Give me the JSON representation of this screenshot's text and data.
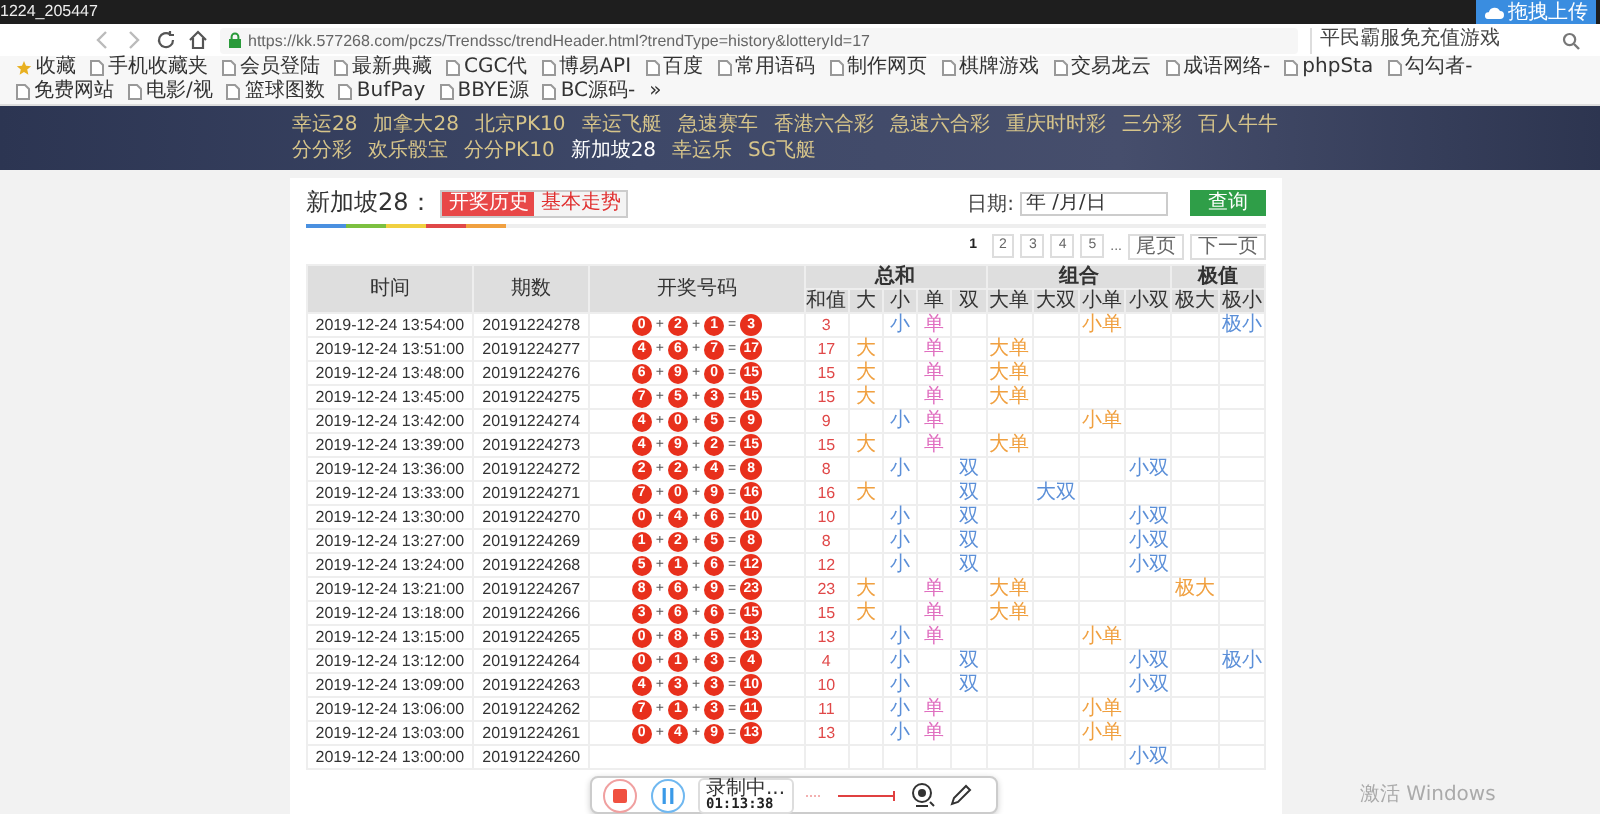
{
  "browser": {
    "tab_title": "1224_205447",
    "upload_button": "拖拽上传",
    "url": "https://kk.577268.com/pczs/Trendssc/trendHeader.html?trendType=history&lotteryId=17",
    "search": "平民霸服免充值游戏",
    "bookmarks": [
      {
        "label": "收藏",
        "kind": "star"
      },
      {
        "label": "手机收藏夹",
        "kind": "page"
      },
      {
        "label": "会员登陆",
        "kind": "page"
      },
      {
        "label": "最新典藏",
        "kind": "page"
      },
      {
        "label": "CGC代",
        "kind": "page"
      },
      {
        "label": "博易API",
        "kind": "page"
      },
      {
        "label": "百度",
        "kind": "page"
      },
      {
        "label": "常用语码",
        "kind": "page"
      },
      {
        "label": "制作网页",
        "kind": "page"
      },
      {
        "label": "棋牌游戏",
        "kind": "page"
      },
      {
        "label": "交易龙云",
        "kind": "page"
      },
      {
        "label": "成语网络-",
        "kind": "page"
      },
      {
        "label": "phpSta",
        "kind": "page"
      },
      {
        "label": "勾勾者-",
        "kind": "page"
      },
      {
        "label": "免费网站",
        "kind": "page"
      },
      {
        "label": "电影/视",
        "kind": "page"
      },
      {
        "label": "篮球图数",
        "kind": "page"
      },
      {
        "label": "BufPay",
        "kind": "page"
      },
      {
        "label": "BBYE源",
        "kind": "page"
      },
      {
        "label": "BC源码-",
        "kind": "page"
      },
      {
        "label": "»",
        "kind": "more"
      }
    ]
  },
  "nav": {
    "links": [
      {
        "label": "幸运28",
        "selected": false
      },
      {
        "label": "加拿大28",
        "selected": false
      },
      {
        "label": "北京PK10",
        "selected": false
      },
      {
        "label": "幸运飞艇",
        "selected": false
      },
      {
        "label": "急速赛车",
        "selected": false
      },
      {
        "label": "香港六合彩",
        "selected": false
      },
      {
        "label": "急速六合彩",
        "selected": false
      },
      {
        "label": "重庆时时彩",
        "selected": false
      },
      {
        "label": "三分彩",
        "selected": false
      },
      {
        "label": "百人牛牛",
        "selected": false
      },
      {
        "label": "分分彩",
        "selected": false
      },
      {
        "label": "欢乐骰宝",
        "selected": false
      },
      {
        "label": "分分PK10",
        "selected": false
      },
      {
        "label": "新加坡28",
        "selected": true
      },
      {
        "label": "幸运乐",
        "selected": false
      },
      {
        "label": "SG飞艇",
        "selected": false
      }
    ]
  },
  "panel": {
    "title": "新加坡28：",
    "tabs": [
      {
        "label": "开奖历史",
        "selected": true
      },
      {
        "label": "基本走势",
        "selected": false
      }
    ],
    "date_label": "日期:",
    "date_placeholder": "年 /月/日",
    "query_button": "查询",
    "pages": [
      {
        "label": "1",
        "kind": "page",
        "selected": true
      },
      {
        "label": "2",
        "kind": "page",
        "selected": false
      },
      {
        "label": "3",
        "kind": "page",
        "selected": false
      },
      {
        "label": "4",
        "kind": "page",
        "selected": false
      },
      {
        "label": "5",
        "kind": "page",
        "selected": false
      },
      {
        "label": "...",
        "kind": "ellipsis",
        "selected": false
      },
      {
        "label": "尾页",
        "kind": "link",
        "selected": false
      },
      {
        "label": "下一页",
        "kind": "link",
        "selected": false
      }
    ]
  },
  "table": {
    "columns": [
      "时间",
      "期数",
      "开奖号码"
    ],
    "operators": [
      "+",
      "+",
      "="
    ],
    "groups": [
      {
        "label": "总和",
        "sub": [
          {
            "label": "和值",
            "kind": "sum"
          },
          {
            "label": "大",
            "kind": "big"
          },
          {
            "label": "小",
            "kind": "small"
          },
          {
            "label": "单",
            "kind": "odd"
          },
          {
            "label": "双",
            "kind": "even"
          }
        ]
      },
      {
        "label": "组合",
        "sub": [
          {
            "label": "大单",
            "kind": "big_odd"
          },
          {
            "label": "大双",
            "kind": "big_even"
          },
          {
            "label": "小单",
            "kind": "small_odd"
          },
          {
            "label": "小双",
            "kind": "small_even"
          }
        ]
      },
      {
        "label": "极值",
        "sub": [
          {
            "label": "极大",
            "kind": "extreme_big"
          },
          {
            "label": "极小",
            "kind": "extreme_small"
          }
        ]
      }
    ],
    "rows": [
      {
        "time": "2019-12-24 13:54:00",
        "period": "20191224278",
        "numbers": [
          "0",
          "2",
          "1"
        ],
        "total": "3",
        "marks": [
          {
            "kind": "sum",
            "text": "3"
          },
          {
            "kind": "small",
            "text": "小"
          },
          {
            "kind": "odd",
            "text": "单"
          },
          {
            "kind": "small_odd",
            "text": "小单"
          },
          {
            "kind": "extreme_small",
            "text": "极小"
          }
        ]
      },
      {
        "time": "2019-12-24 13:51:00",
        "period": "20191224277",
        "numbers": [
          "4",
          "6",
          "7"
        ],
        "total": "17",
        "marks": [
          {
            "kind": "sum",
            "text": "17"
          },
          {
            "kind": "big",
            "text": "大"
          },
          {
            "kind": "odd",
            "text": "单"
          },
          {
            "kind": "big_odd",
            "text": "大单"
          }
        ]
      },
      {
        "time": "2019-12-24 13:48:00",
        "period": "20191224276",
        "numbers": [
          "6",
          "9",
          "0"
        ],
        "total": "15",
        "marks": [
          {
            "kind": "sum",
            "text": "15"
          },
          {
            "kind": "big",
            "text": "大"
          },
          {
            "kind": "odd",
            "text": "单"
          },
          {
            "kind": "big_odd",
            "text": "大单"
          }
        ]
      },
      {
        "time": "2019-12-24 13:45:00",
        "period": "20191224275",
        "numbers": [
          "7",
          "5",
          "3"
        ],
        "total": "15",
        "marks": [
          {
            "kind": "sum",
            "text": "15"
          },
          {
            "kind": "big",
            "text": "大"
          },
          {
            "kind": "odd",
            "text": "单"
          },
          {
            "kind": "big_odd",
            "text": "大单"
          }
        ]
      },
      {
        "time": "2019-12-24 13:42:00",
        "period": "20191224274",
        "numbers": [
          "4",
          "0",
          "5"
        ],
        "total": "9",
        "marks": [
          {
            "kind": "sum",
            "text": "9"
          },
          {
            "kind": "small",
            "text": "小"
          },
          {
            "kind": "odd",
            "text": "单"
          },
          {
            "kind": "small_odd",
            "text": "小单"
          }
        ]
      },
      {
        "time": "2019-12-24 13:39:00",
        "period": "20191224273",
        "numbers": [
          "4",
          "9",
          "2"
        ],
        "total": "15",
        "marks": [
          {
            "kind": "sum",
            "text": "15"
          },
          {
            "kind": "big",
            "text": "大"
          },
          {
            "kind": "odd",
            "text": "单"
          },
          {
            "kind": "big_odd",
            "text": "大单"
          }
        ]
      },
      {
        "time": "2019-12-24 13:36:00",
        "period": "20191224272",
        "numbers": [
          "2",
          "2",
          "4"
        ],
        "total": "8",
        "marks": [
          {
            "kind": "sum",
            "text": "8"
          },
          {
            "kind": "small",
            "text": "小"
          },
          {
            "kind": "even",
            "text": "双"
          },
          {
            "kind": "small_even",
            "text": "小双"
          }
        ]
      },
      {
        "time": "2019-12-24 13:33:00",
        "period": "20191224271",
        "numbers": [
          "7",
          "0",
          "9"
        ],
        "total": "16",
        "marks": [
          {
            "kind": "sum",
            "text": "16"
          },
          {
            "kind": "big",
            "text": "大"
          },
          {
            "kind": "even",
            "text": "双"
          },
          {
            "kind": "big_even",
            "text": "大双"
          }
        ]
      },
      {
        "time": "2019-12-24 13:30:00",
        "period": "20191224270",
        "numbers": [
          "0",
          "4",
          "6"
        ],
        "total": "10",
        "marks": [
          {
            "kind": "sum",
            "text": "10"
          },
          {
            "kind": "small",
            "text": "小"
          },
          {
            "kind": "even",
            "text": "双"
          },
          {
            "kind": "small_even",
            "text": "小双"
          }
        ]
      },
      {
        "time": "2019-12-24 13:27:00",
        "period": "20191224269",
        "numbers": [
          "1",
          "2",
          "5"
        ],
        "total": "8",
        "marks": [
          {
            "kind": "sum",
            "text": "8"
          },
          {
            "kind": "small",
            "text": "小"
          },
          {
            "kind": "even",
            "text": "双"
          },
          {
            "kind": "small_even",
            "text": "小双"
          }
        ]
      },
      {
        "time": "2019-12-24 13:24:00",
        "period": "20191224268",
        "numbers": [
          "5",
          "1",
          "6"
        ],
        "total": "12",
        "marks": [
          {
            "kind": "sum",
            "text": "12"
          },
          {
            "kind": "small",
            "text": "小"
          },
          {
            "kind": "even",
            "text": "双"
          },
          {
            "kind": "small_even",
            "text": "小双"
          }
        ]
      },
      {
        "time": "2019-12-24 13:21:00",
        "period": "20191224267",
        "numbers": [
          "8",
          "6",
          "9"
        ],
        "total": "23",
        "marks": [
          {
            "kind": "sum",
            "text": "23"
          },
          {
            "kind": "big",
            "text": "大"
          },
          {
            "kind": "odd",
            "text": "单"
          },
          {
            "kind": "big_odd",
            "text": "大单"
          },
          {
            "kind": "extreme_big",
            "text": "极大"
          }
        ]
      },
      {
        "time": "2019-12-24 13:18:00",
        "period": "20191224266",
        "numbers": [
          "3",
          "6",
          "6"
        ],
        "total": "15",
        "marks": [
          {
            "kind": "sum",
            "text": "15"
          },
          {
            "kind": "big",
            "text": "大"
          },
          {
            "kind": "odd",
            "text": "单"
          },
          {
            "kind": "big_odd",
            "text": "大单"
          }
        ]
      },
      {
        "time": "2019-12-24 13:15:00",
        "period": "20191224265",
        "numbers": [
          "0",
          "8",
          "5"
        ],
        "total": "13",
        "marks": [
          {
            "kind": "sum",
            "text": "13"
          },
          {
            "kind": "small",
            "text": "小"
          },
          {
            "kind": "odd",
            "text": "单"
          },
          {
            "kind": "small_odd",
            "text": "小单"
          }
        ]
      },
      {
        "time": "2019-12-24 13:12:00",
        "period": "20191224264",
        "numbers": [
          "0",
          "1",
          "3"
        ],
        "total": "4",
        "marks": [
          {
            "kind": "sum",
            "text": "4"
          },
          {
            "kind": "small",
            "text": "小"
          },
          {
            "kind": "even",
            "text": "双"
          },
          {
            "kind": "small_even",
            "text": "小双"
          },
          {
            "kind": "extreme_small",
            "text": "极小"
          }
        ]
      },
      {
        "time": "2019-12-24 13:09:00",
        "period": "20191224263",
        "numbers": [
          "4",
          "3",
          "3"
        ],
        "total": "10",
        "marks": [
          {
            "kind": "sum",
            "text": "10"
          },
          {
            "kind": "small",
            "text": "小"
          },
          {
            "kind": "even",
            "text": "双"
          },
          {
            "kind": "small_even",
            "text": "小双"
          }
        ]
      },
      {
        "time": "2019-12-24 13:06:00",
        "period": "20191224262",
        "numbers": [
          "7",
          "1",
          "3"
        ],
        "total": "11",
        "marks": [
          {
            "kind": "sum",
            "text": "11"
          },
          {
            "kind": "small",
            "text": "小"
          },
          {
            "kind": "odd",
            "text": "单"
          },
          {
            "kind": "small_odd",
            "text": "小单"
          }
        ]
      },
      {
        "time": "2019-12-24 13:03:00",
        "period": "20191224261",
        "numbers": [
          "0",
          "4",
          "9"
        ],
        "total": "13",
        "marks": [
          {
            "kind": "sum",
            "text": "13"
          },
          {
            "kind": "small",
            "text": "小"
          },
          {
            "kind": "odd",
            "text": "单"
          },
          {
            "kind": "small_odd",
            "text": "小单"
          }
        ]
      },
      {
        "time": "2019-12-24 13:00:00",
        "period": "20191224260",
        "marks": [
          {
            "kind": "small_even",
            "text": "小双"
          }
        ]
      }
    ]
  },
  "recorder": {
    "status": "录制中...",
    "time": "01:13:38"
  },
  "os_notice": "激活 Windows"
}
